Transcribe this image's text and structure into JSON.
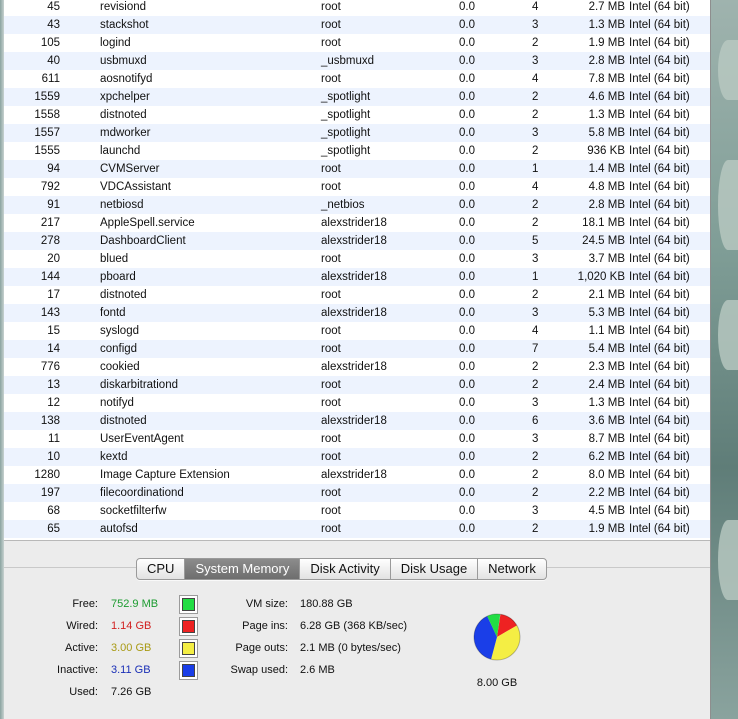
{
  "processes": [
    {
      "pid": "45",
      "name": "revisiond",
      "user": "root",
      "cpu": "0.0",
      "threads": "4",
      "mem": "2.7 MB",
      "kind": "Intel (64 bit)"
    },
    {
      "pid": "43",
      "name": "stackshot",
      "user": "root",
      "cpu": "0.0",
      "threads": "3",
      "mem": "1.3 MB",
      "kind": "Intel (64 bit)"
    },
    {
      "pid": "105",
      "name": "logind",
      "user": "root",
      "cpu": "0.0",
      "threads": "2",
      "mem": "1.9 MB",
      "kind": "Intel (64 bit)"
    },
    {
      "pid": "40",
      "name": "usbmuxd",
      "user": "_usbmuxd",
      "cpu": "0.0",
      "threads": "3",
      "mem": "2.8 MB",
      "kind": "Intel (64 bit)"
    },
    {
      "pid": "611",
      "name": "aosnotifyd",
      "user": "root",
      "cpu": "0.0",
      "threads": "4",
      "mem": "7.8 MB",
      "kind": "Intel (64 bit)"
    },
    {
      "pid": "1559",
      "name": "xpchelper",
      "user": "_spotlight",
      "cpu": "0.0",
      "threads": "2",
      "mem": "4.6 MB",
      "kind": "Intel (64 bit)"
    },
    {
      "pid": "1558",
      "name": "distnoted",
      "user": "_spotlight",
      "cpu": "0.0",
      "threads": "2",
      "mem": "1.3 MB",
      "kind": "Intel (64 bit)"
    },
    {
      "pid": "1557",
      "name": "mdworker",
      "user": "_spotlight",
      "cpu": "0.0",
      "threads": "3",
      "mem": "5.8 MB",
      "kind": "Intel (64 bit)"
    },
    {
      "pid": "1555",
      "name": "launchd",
      "user": "_spotlight",
      "cpu": "0.0",
      "threads": "2",
      "mem": "936 KB",
      "kind": "Intel (64 bit)"
    },
    {
      "pid": "94",
      "name": "CVMServer",
      "user": "root",
      "cpu": "0.0",
      "threads": "1",
      "mem": "1.4 MB",
      "kind": "Intel (64 bit)"
    },
    {
      "pid": "792",
      "name": "VDCAssistant",
      "user": "root",
      "cpu": "0.0",
      "threads": "4",
      "mem": "4.8 MB",
      "kind": "Intel (64 bit)"
    },
    {
      "pid": "91",
      "name": "netbiosd",
      "user": "_netbios",
      "cpu": "0.0",
      "threads": "2",
      "mem": "2.8 MB",
      "kind": "Intel (64 bit)"
    },
    {
      "pid": "217",
      "name": "AppleSpell.service",
      "user": "alexstrider18",
      "cpu": "0.0",
      "threads": "2",
      "mem": "18.1 MB",
      "kind": "Intel (64 bit)"
    },
    {
      "pid": "278",
      "name": "DashboardClient",
      "user": "alexstrider18",
      "cpu": "0.0",
      "threads": "5",
      "mem": "24.5 MB",
      "kind": "Intel (64 bit)"
    },
    {
      "pid": "20",
      "name": "blued",
      "user": "root",
      "cpu": "0.0",
      "threads": "3",
      "mem": "3.7 MB",
      "kind": "Intel (64 bit)"
    },
    {
      "pid": "144",
      "name": "pboard",
      "user": "alexstrider18",
      "cpu": "0.0",
      "threads": "1",
      "mem": "1,020 KB",
      "kind": "Intel (64 bit)"
    },
    {
      "pid": "17",
      "name": "distnoted",
      "user": "root",
      "cpu": "0.0",
      "threads": "2",
      "mem": "2.1 MB",
      "kind": "Intel (64 bit)"
    },
    {
      "pid": "143",
      "name": "fontd",
      "user": "alexstrider18",
      "cpu": "0.0",
      "threads": "3",
      "mem": "5.3 MB",
      "kind": "Intel (64 bit)"
    },
    {
      "pid": "15",
      "name": "syslogd",
      "user": "root",
      "cpu": "0.0",
      "threads": "4",
      "mem": "1.1 MB",
      "kind": "Intel (64 bit)"
    },
    {
      "pid": "14",
      "name": "configd",
      "user": "root",
      "cpu": "0.0",
      "threads": "7",
      "mem": "5.4 MB",
      "kind": "Intel (64 bit)"
    },
    {
      "pid": "776",
      "name": "cookied",
      "user": "alexstrider18",
      "cpu": "0.0",
      "threads": "2",
      "mem": "2.3 MB",
      "kind": "Intel (64 bit)"
    },
    {
      "pid": "13",
      "name": "diskarbitrationd",
      "user": "root",
      "cpu": "0.0",
      "threads": "2",
      "mem": "2.4 MB",
      "kind": "Intel (64 bit)"
    },
    {
      "pid": "12",
      "name": "notifyd",
      "user": "root",
      "cpu": "0.0",
      "threads": "3",
      "mem": "1.3 MB",
      "kind": "Intel (64 bit)"
    },
    {
      "pid": "138",
      "name": "distnoted",
      "user": "alexstrider18",
      "cpu": "0.0",
      "threads": "6",
      "mem": "3.6 MB",
      "kind": "Intel (64 bit)"
    },
    {
      "pid": "11",
      "name": "UserEventAgent",
      "user": "root",
      "cpu": "0.0",
      "threads": "3",
      "mem": "8.7 MB",
      "kind": "Intel (64 bit)"
    },
    {
      "pid": "10",
      "name": "kextd",
      "user": "root",
      "cpu": "0.0",
      "threads": "2",
      "mem": "6.2 MB",
      "kind": "Intel (64 bit)"
    },
    {
      "pid": "1280",
      "name": "Image Capture Extension",
      "user": "alexstrider18",
      "cpu": "0.0",
      "threads": "2",
      "mem": "8.0 MB",
      "kind": "Intel (64 bit)"
    },
    {
      "pid": "197",
      "name": "filecoordinationd",
      "user": "root",
      "cpu": "0.0",
      "threads": "2",
      "mem": "2.2 MB",
      "kind": "Intel (64 bit)"
    },
    {
      "pid": "68",
      "name": "socketfilterfw",
      "user": "root",
      "cpu": "0.0",
      "threads": "3",
      "mem": "4.5 MB",
      "kind": "Intel (64 bit)"
    },
    {
      "pid": "65",
      "name": "autofsd",
      "user": "root",
      "cpu": "0.0",
      "threads": "2",
      "mem": "1.9 MB",
      "kind": "Intel (64 bit)"
    }
  ],
  "tabs": {
    "cpu": "CPU",
    "system_memory": "System Memory",
    "disk_activity": "Disk Activity",
    "disk_usage": "Disk Usage",
    "network": "Network",
    "active": "system_memory"
  },
  "memory": {
    "free_label": "Free:",
    "free_value": "752.9 MB",
    "free_color": "#1b9b2f",
    "free_swatch": "#22dd44",
    "wired_label": "Wired:",
    "wired_value": "1.14 GB",
    "wired_color": "#d11f1f",
    "wired_swatch": "#ee2222",
    "active_label": "Active:",
    "active_value": "3.00 GB",
    "active_color": "#a89a14",
    "active_swatch": "#f4ee44",
    "inactive_label": "Inactive:",
    "inactive_value": "3.11 GB",
    "inactive_color": "#1a2fb6",
    "inactive_swatch": "#1a3ee8",
    "used_label": "Used:",
    "used_value": "7.26 GB",
    "vm_size_label": "VM size:",
    "vm_size_value": "180.88 GB",
    "page_ins_label": "Page ins:",
    "page_ins_value": "6.28 GB (368 KB/sec)",
    "page_outs_label": "Page outs:",
    "page_outs_value": "2.1 MB (0 bytes/sec)",
    "swap_used_label": "Swap used:",
    "swap_used_value": "2.6 MB",
    "total": "8.00 GB"
  },
  "pie": {
    "free": 0.092,
    "wired": 0.1425,
    "active": 0.375,
    "inactive": 0.389
  }
}
